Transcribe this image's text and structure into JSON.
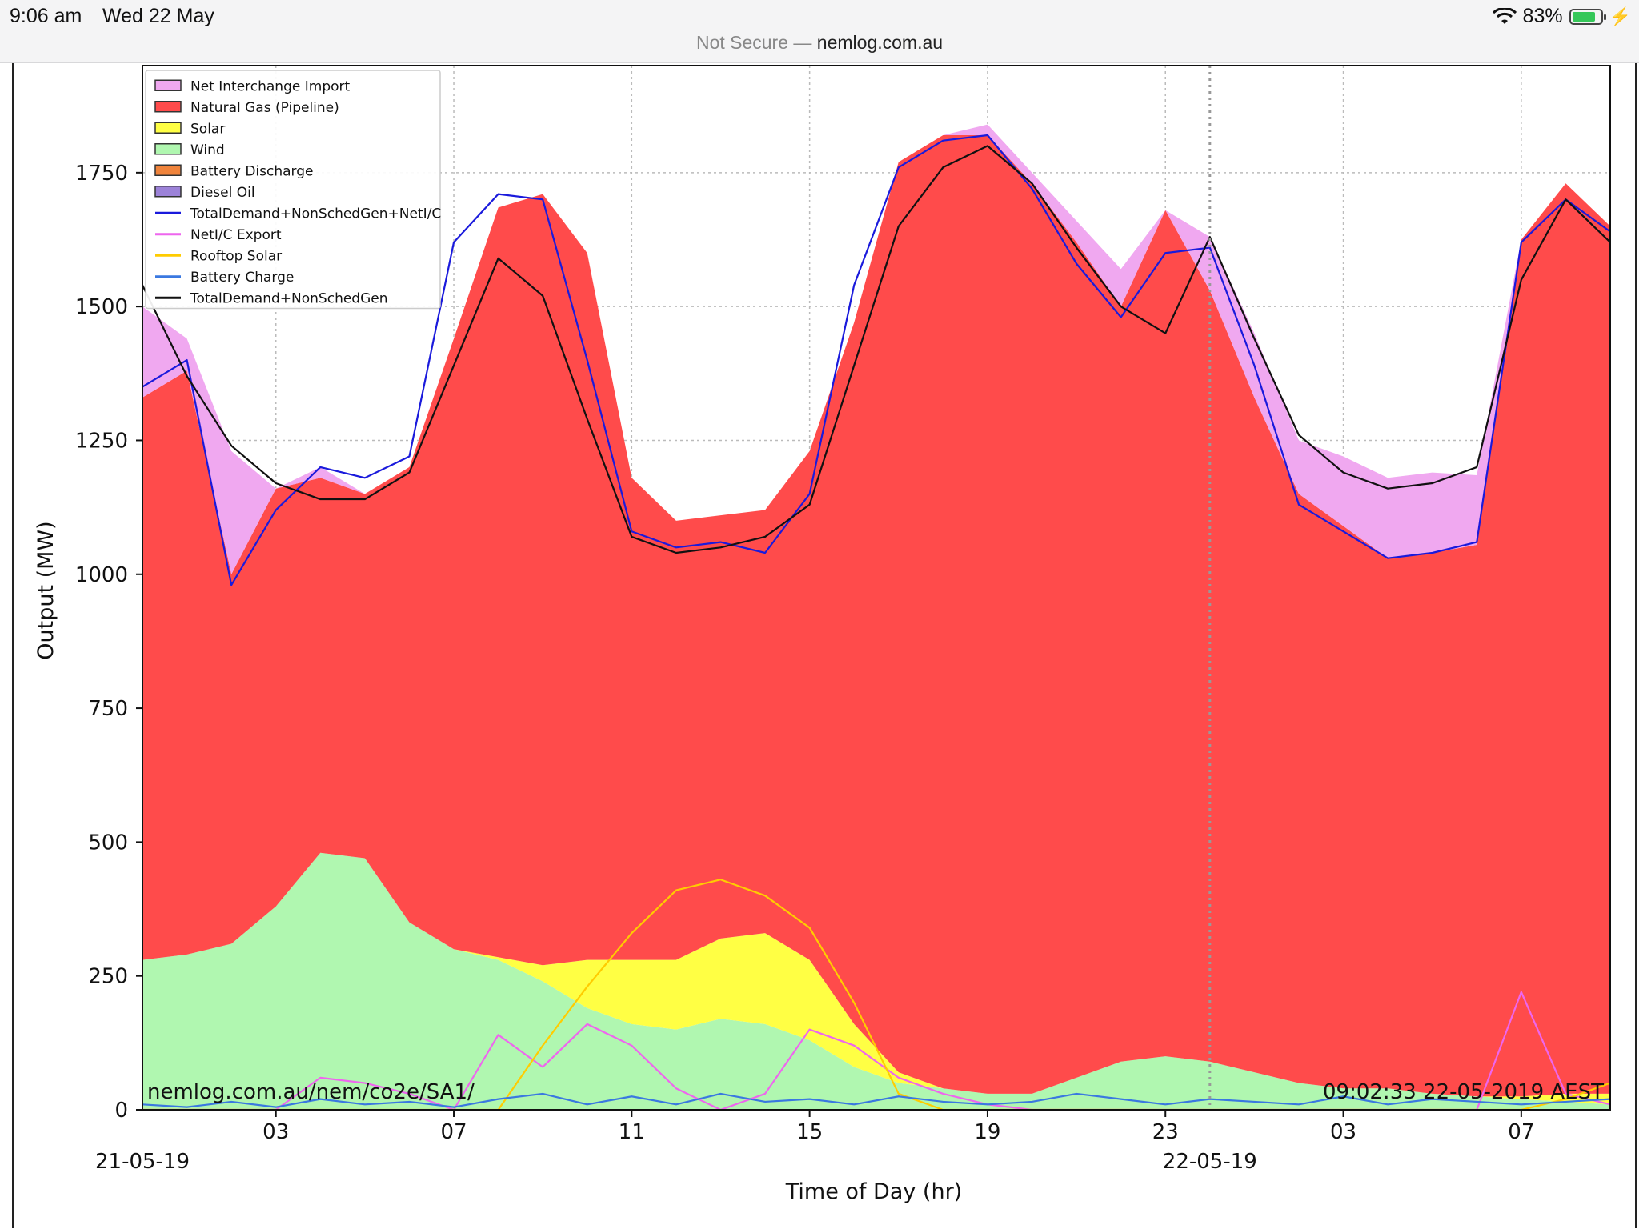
{
  "status_bar": {
    "time": "9:06 am",
    "date": "Wed 22 May",
    "battery": "83%",
    "battery_level": 0.83,
    "security": "Not Secure —",
    "host": "nemlog.com.au"
  },
  "chart_data": {
    "type": "area",
    "title": "",
    "xlabel": "Time of Day (hr)",
    "ylabel": "Output (MW)",
    "xlim": [
      0,
      33
    ],
    "ylim": [
      0,
      1950
    ],
    "x_unit": "hours since 00:00 21-05-19",
    "x_ticks": [
      {
        "x": 3,
        "label": "03"
      },
      {
        "x": 7,
        "label": "07"
      },
      {
        "x": 11,
        "label": "11"
      },
      {
        "x": 15,
        "label": "15"
      },
      {
        "x": 19,
        "label": "19"
      },
      {
        "x": 23,
        "label": "23"
      },
      {
        "x": 27,
        "label": "03"
      },
      {
        "x": 31,
        "label": "07"
      }
    ],
    "date_labels": [
      {
        "x": 0,
        "label": "21-05-19"
      },
      {
        "x": 24,
        "label": "22-05-19"
      }
    ],
    "y_ticks": [
      0,
      250,
      500,
      750,
      1000,
      1250,
      1500,
      1750
    ],
    "grid": true,
    "day_divider_x": 24,
    "legend_position": "top-left",
    "annotations": {
      "left": "nemlog.com.au/nem/co2e/SA1/",
      "right": "09:02:33 22-05-2019 AEST"
    },
    "x": [
      0,
      1,
      2,
      3,
      4,
      5,
      6,
      7,
      8,
      9,
      10,
      11,
      12,
      13,
      14,
      15,
      16,
      17,
      18,
      19,
      20,
      21,
      22,
      23,
      24,
      25,
      26,
      27,
      28,
      29,
      30,
      31,
      32,
      33
    ],
    "series": [
      {
        "name": "Wind",
        "kind": "stack",
        "color": "#b0f7b0",
        "values": [
          280,
          290,
          310,
          380,
          480,
          470,
          350,
          300,
          280,
          240,
          190,
          160,
          150,
          170,
          160,
          130,
          80,
          50,
          40,
          30,
          30,
          60,
          90,
          100,
          90,
          70,
          50,
          40,
          40,
          30,
          25,
          20,
          15,
          10
        ]
      },
      {
        "name": "Solar",
        "kind": "stack",
        "color": "#ffff44",
        "values": [
          0,
          0,
          0,
          0,
          0,
          0,
          0,
          0,
          5,
          30,
          90,
          120,
          130,
          150,
          170,
          150,
          80,
          20,
          0,
          0,
          0,
          0,
          0,
          0,
          0,
          0,
          0,
          0,
          0,
          0,
          0,
          5,
          15,
          20
        ]
      },
      {
        "name": "Battery Discharge",
        "kind": "stack",
        "color": "#f0843c",
        "values": [
          0,
          0,
          0,
          0,
          0,
          0,
          0,
          0,
          0,
          0,
          0,
          0,
          0,
          0,
          0,
          0,
          0,
          0,
          0,
          0,
          0,
          0,
          0,
          0,
          0,
          0,
          0,
          0,
          0,
          0,
          0,
          0,
          0,
          0
        ]
      },
      {
        "name": "Diesel Oil",
        "kind": "stack",
        "color": "#9c82d8",
        "values": [
          0,
          0,
          0,
          0,
          0,
          0,
          0,
          0,
          0,
          0,
          0,
          0,
          0,
          0,
          0,
          0,
          0,
          0,
          0,
          0,
          0,
          0,
          0,
          0,
          0,
          0,
          0,
          0,
          0,
          0,
          0,
          0,
          0,
          0
        ]
      },
      {
        "name": "Natural Gas (Pipeline)",
        "kind": "stack",
        "color": "#ff4b4b",
        "values": [
          1050,
          1090,
          690,
          780,
          700,
          680,
          850,
          1140,
          1400,
          1440,
          1320,
          900,
          820,
          790,
          790,
          950,
          1310,
          1700,
          1780,
          1790,
          1700,
          1560,
          1410,
          1580,
          1440,
          1260,
          1100,
          1050,
          990,
          1010,
          1030,
          1600,
          1700,
          1620
        ]
      },
      {
        "name": "Net Interchange Import",
        "kind": "stack",
        "color": "#f0a8f0",
        "values": [
          170,
          60,
          230,
          0,
          20,
          0,
          0,
          0,
          0,
          0,
          0,
          0,
          0,
          0,
          0,
          0,
          0,
          0,
          0,
          20,
          20,
          40,
          70,
          0,
          100,
          120,
          100,
          130,
          150,
          150,
          130,
          0,
          0,
          0
        ]
      },
      {
        "name": "TotalDemand+NonSchedGen+NetI/C",
        "kind": "line",
        "color": "#1a1adc",
        "values": [
          1350,
          1400,
          980,
          1120,
          1200,
          1180,
          1220,
          1620,
          1710,
          1700,
          1400,
          1080,
          1050,
          1060,
          1040,
          1150,
          1540,
          1760,
          1810,
          1820,
          1720,
          1580,
          1480,
          1600,
          1610,
          1390,
          1130,
          1080,
          1030,
          1040,
          1060,
          1620,
          1700,
          1640
        ]
      },
      {
        "name": "NetI/C Export",
        "kind": "line",
        "color": "#ee66ee",
        "values": [
          0,
          0,
          0,
          0,
          60,
          50,
          30,
          0,
          140,
          80,
          160,
          120,
          40,
          0,
          30,
          150,
          120,
          60,
          30,
          10,
          0,
          0,
          0,
          0,
          0,
          0,
          0,
          0,
          0,
          0,
          0,
          220,
          30,
          10
        ]
      },
      {
        "name": "Rooftop Solar",
        "kind": "line",
        "color": "#ffcc00",
        "values": [
          0,
          0,
          0,
          0,
          0,
          0,
          0,
          0,
          0,
          120,
          230,
          330,
          410,
          430,
          400,
          340,
          200,
          30,
          0,
          0,
          0,
          0,
          0,
          0,
          0,
          0,
          0,
          0,
          0,
          0,
          0,
          0,
          20,
          50
        ]
      },
      {
        "name": "Battery Charge",
        "kind": "line",
        "color": "#3a78e0",
        "values": [
          10,
          5,
          15,
          5,
          20,
          10,
          15,
          5,
          20,
          30,
          10,
          25,
          10,
          30,
          15,
          20,
          10,
          25,
          15,
          10,
          15,
          30,
          20,
          10,
          20,
          15,
          10,
          25,
          10,
          20,
          15,
          10,
          15,
          20
        ]
      },
      {
        "name": "TotalDemand+NonSchedGen",
        "kind": "line",
        "color": "#111111",
        "values": [
          1540,
          1370,
          1240,
          1170,
          1140,
          1140,
          1190,
          1390,
          1590,
          1520,
          1290,
          1070,
          1040,
          1050,
          1070,
          1130,
          1390,
          1650,
          1760,
          1800,
          1730,
          1610,
          1500,
          1450,
          1630,
          1440,
          1260,
          1190,
          1160,
          1170,
          1200,
          1550,
          1700,
          1620
        ]
      }
    ]
  }
}
